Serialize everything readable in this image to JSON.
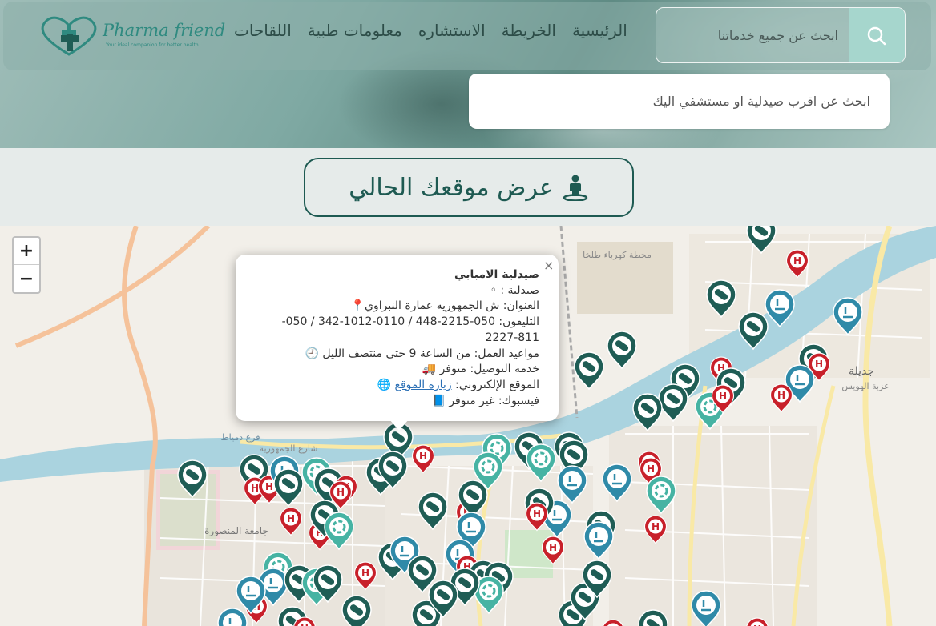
{
  "brand": {
    "name": "Pharma friend",
    "tagline": "Your ideal companion for better health",
    "color": "#2f8a80"
  },
  "nav": {
    "items": [
      "الرئيسية",
      "الخريطة",
      "الاستشاره",
      "معلومات طبية",
      "اللقاحات"
    ]
  },
  "search": {
    "placeholder": "ابحث عن جميع خدماتنا",
    "icon": "search-icon"
  },
  "place_search": {
    "placeholder": "ابحث عن اقرب صيدلية او مستشفي اليك"
  },
  "locate": {
    "label": "عرض موقعك الحالي",
    "icon": "street-view-icon"
  },
  "map": {
    "zoom_in": "+",
    "zoom_out": "−",
    "labels": [
      "جامعة المنصورة",
      "محطة كهرباء طلخا",
      "جديلة",
      "عزبة الهويس",
      "شارع الجمهورية",
      "فرع دمياط"
    ]
  },
  "popup": {
    "close": "×",
    "title": "صيدلية الامبابي",
    "type": "صيدلية :",
    "address": "العنوان: ش الجمهوريه عمارة النبراوي",
    "phone": "التليفون: 050-2215-448 / 0110-1012-342 / 050- 811-2227",
    "hours": "مواعيد العمل: من الساعة 9 حتى منتصف الليل",
    "delivery": "خدمة التوصيل: متوفر",
    "website_label": "الموقع الإلكتروني:",
    "website_link": "زيارة الموقع",
    "facebook": "فيسبوك: غير متوفر"
  },
  "colors": {
    "pharmacy_marker": "#1f5d55",
    "hospital_marker": "#c8202a",
    "lab_marker": "#46b3a3",
    "clinic_marker": "#2f8aa8",
    "accent": "#1e5a52"
  }
}
